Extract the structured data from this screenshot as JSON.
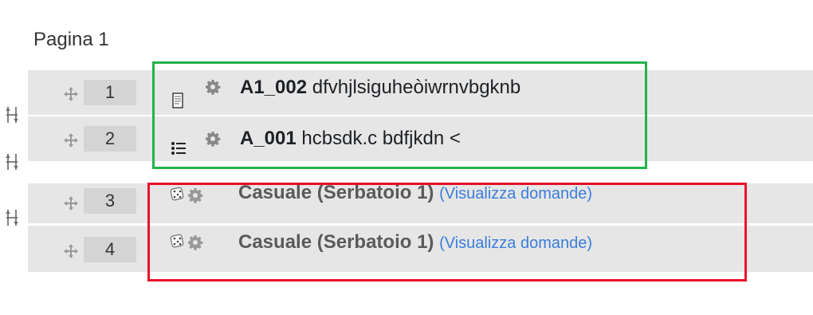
{
  "page": {
    "title": "Pagina 1"
  },
  "questions": [
    {
      "number": "1",
      "type_icon": "document-icon",
      "name": "A1_002",
      "text": " dfvhjlsiguheòiwrnvbgknb"
    },
    {
      "number": "2",
      "type_icon": "list-icon",
      "name": "A_001",
      "text": " hcbsdk.c bdfjkdn <"
    },
    {
      "number": "3",
      "type_icon": "dice-icon",
      "name": "Casuale (Serbatoio 1)",
      "link": "(Visualizza domande)"
    },
    {
      "number": "4",
      "type_icon": "dice-icon",
      "name": "Casuale (Serbatoio 1)",
      "link": "(Visualizza domande)"
    }
  ],
  "colors": {
    "green_highlight": "#22b14c",
    "red_highlight": "#e8102a",
    "link": "#3b7ddd"
  }
}
